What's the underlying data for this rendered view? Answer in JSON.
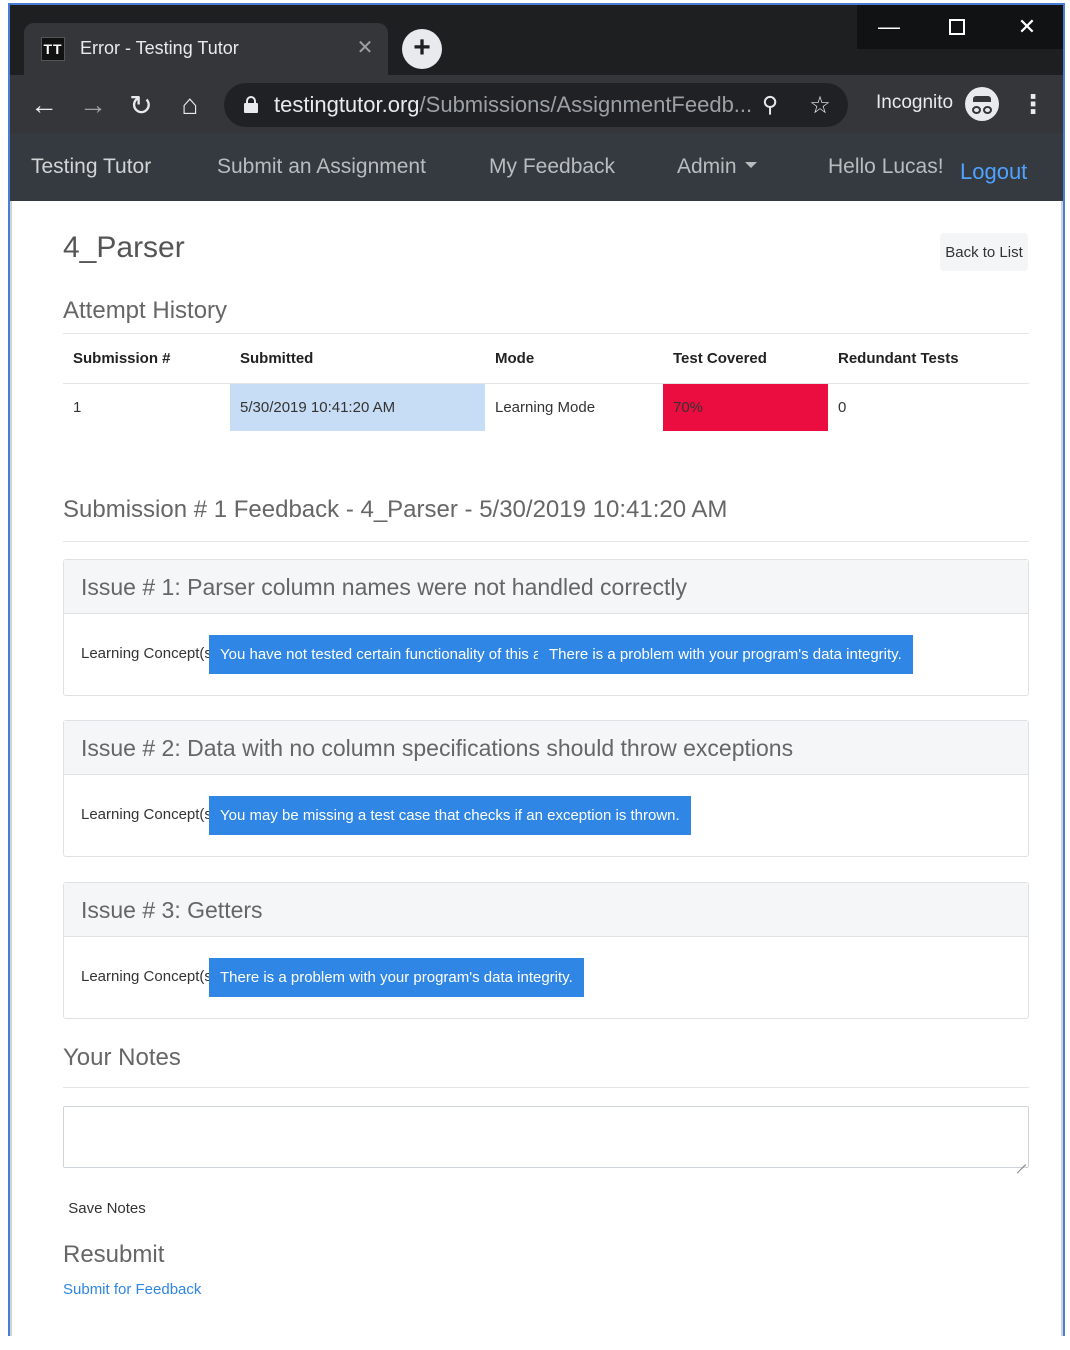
{
  "browser": {
    "tab_title": "Error - Testing Tutor",
    "tab_favicon_text": "TT",
    "url_host": "testingtutor.org",
    "url_path": "/Submissions/AssignmentFeedb...",
    "incognito_label": "Incognito",
    "icons": [
      "back-arrow-icon",
      "forward-arrow-icon",
      "reload-icon",
      "home-icon",
      "lock-icon",
      "zoom-icon",
      "star-icon",
      "incognito-icon",
      "menu-dots-icon",
      "minimize-icon",
      "maximize-icon",
      "close-icon",
      "new-tab-icon"
    ]
  },
  "nav": {
    "brand": "Testing Tutor",
    "submit": "Submit an Assignment",
    "feedback": "My Feedback",
    "admin": "Admin",
    "greeting": "Hello Lucas!",
    "logout": "Logout"
  },
  "page": {
    "title": "4_Parser",
    "back_label": "Back to List",
    "attempt_heading": "Attempt History",
    "columns": [
      "Submission #",
      "Submitted",
      "Mode",
      "Test Covered",
      "Redundant Tests"
    ],
    "rows": [
      {
        "submission": "1",
        "submitted": "5/30/2019 10:41:20 AM",
        "mode": "Learning Mode",
        "covered": "70%",
        "redundant": "0"
      }
    ],
    "feedback_heading": "Submission # 1 Feedback - 4_Parser - 5/30/2019 10:41:20 AM",
    "concept_label": "Learning Concept(s):",
    "issues": [
      {
        "title": "Issue # 1: Parser column names were not handled correctly",
        "concepts": [
          "You have not tested certain functionality of this area.",
          "There is a problem with your program's data integrity."
        ]
      },
      {
        "title": "Issue # 2: Data with no column specifications should throw exceptions",
        "concepts": [
          "You may be missing a test case that checks if an exception is thrown."
        ]
      },
      {
        "title": "Issue # 3: Getters",
        "concepts": [
          "There is a problem with your program's data integrity."
        ]
      }
    ],
    "notes_heading": "Your Notes",
    "notes_value": "",
    "save_label": "Save Notes",
    "resubmit_heading": "Resubmit",
    "resubmit_link": "Submit for Feedback"
  },
  "colors": {
    "accent": "#2f86e5",
    "covered_cell": "#eb0d3f",
    "submitted_cell": "#c7dcf5",
    "navbar": "#343a40"
  }
}
